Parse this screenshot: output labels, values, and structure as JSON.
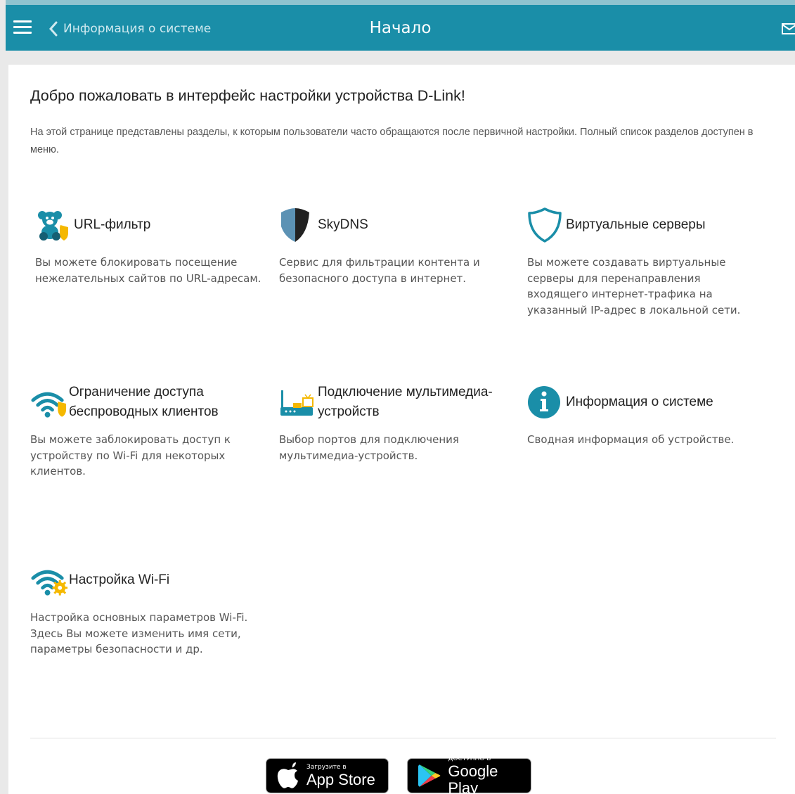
{
  "header": {
    "back_label": "Информация о системе",
    "title": "Начало"
  },
  "main": {
    "heading": "Добро пожаловать в интерфейс настройки устройства D-Link!",
    "intro": "На этой странице представлены разделы, к которым пользователи часто обращаются после первичной настройки. Полный список разделов доступен в меню."
  },
  "cards": [
    {
      "title": "URL-фильтр",
      "desc": "Вы можете блокировать посещение нежелательных сайтов по URL-адресам.",
      "icon": "teddy-bear-shield-icon"
    },
    {
      "title": "SkyDNS",
      "desc": "Сервис для фильтрации контента и безопасного доступа в интернет.",
      "icon": "skydns-shield-icon"
    },
    {
      "title": "Виртуальные серверы",
      "desc": "Вы можете создавать виртуальные серверы для перенаправления входящего интернет-трафика на указанный IP-адрес в локальной сети.",
      "icon": "shield-outline-icon"
    },
    {
      "title": "Ограничение доступа беспроводных клиентов",
      "desc": "Вы можете заблокировать доступ к устройству по Wi-Fi для некоторых клиентов.",
      "icon": "wifi-shield-icon"
    },
    {
      "title": "Подключение мультимедиа-устройств",
      "desc": "Выбор портов для подключения мультимедиа-устройств.",
      "icon": "router-tv-icon"
    },
    {
      "title": "Информация о системе",
      "desc": "Сводная информация об устройстве.",
      "icon": "info-icon"
    },
    {
      "title": "Настройка Wi-Fi",
      "desc": "Настройка основных параметров Wi-Fi. Здесь Вы можете изменить имя сети, параметры безопасности и др.",
      "icon": "wifi-gear-icon"
    }
  ],
  "stores": {
    "appstore_small": "Загрузите в",
    "appstore_big": "App Store",
    "googleplay_small": "ДОСТУПНО В",
    "googleplay_big": "Google Play"
  },
  "colors": {
    "header_bg": "#1a8ea8",
    "accent": "#1a8ea8",
    "warning_yellow": "#f5b800"
  }
}
